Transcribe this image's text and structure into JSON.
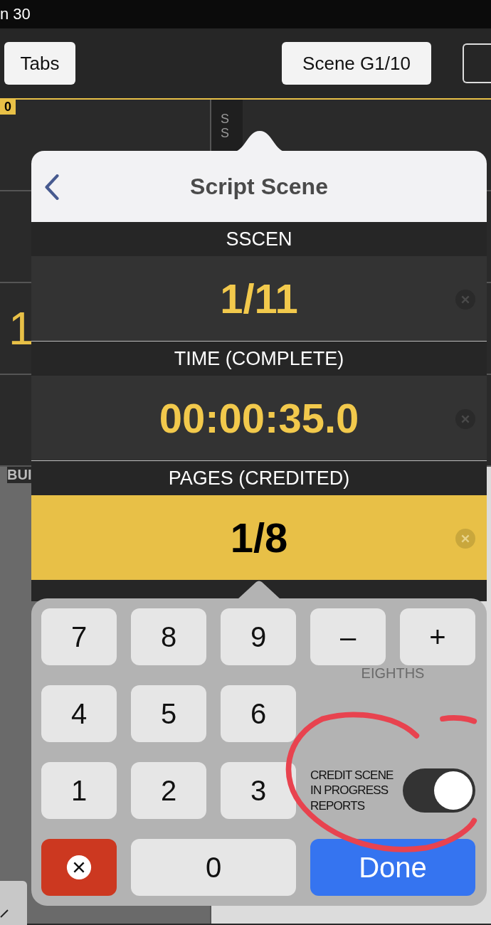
{
  "status_bar": {
    "text": "n 30"
  },
  "toolbar": {
    "buttons": [
      "Tabs",
      "Scene G1/10"
    ]
  },
  "grid": {
    "badge": "0",
    "value": "1",
    "side_label": "SS",
    "footer_label": "BUI"
  },
  "popover": {
    "title": "Script Scene",
    "fields": [
      {
        "label": "SSCEN",
        "value": "1/11",
        "selected": false
      },
      {
        "label": "TIME (COMPLETE)",
        "value": "00:00:35.0",
        "selected": false
      },
      {
        "label": "PAGES (CREDITED)",
        "value": "1/8",
        "selected": true
      }
    ],
    "keypad": {
      "keys": [
        {
          "kind": "digit",
          "label": "7"
        },
        {
          "kind": "digit",
          "label": "8"
        },
        {
          "kind": "digit",
          "label": "9"
        },
        {
          "kind": "op",
          "label": "–"
        },
        {
          "kind": "op",
          "label": "+"
        },
        {
          "kind": "digit",
          "label": "4"
        },
        {
          "kind": "digit",
          "label": "5"
        },
        {
          "kind": "digit",
          "label": "6"
        },
        {
          "kind": "digit",
          "label": "1"
        },
        {
          "kind": "digit",
          "label": "2"
        },
        {
          "kind": "digit",
          "label": "3"
        },
        {
          "kind": "clear"
        },
        {
          "kind": "zero",
          "label": "0"
        },
        {
          "kind": "done",
          "label": "Done"
        }
      ],
      "unit_label": "EIGHTHS",
      "toggle": {
        "label": "CREDIT SCENE IN PROGRESS REPORTS",
        "on": true
      }
    }
  },
  "annotation": {
    "kind": "circle",
    "color": "#e8434f"
  }
}
